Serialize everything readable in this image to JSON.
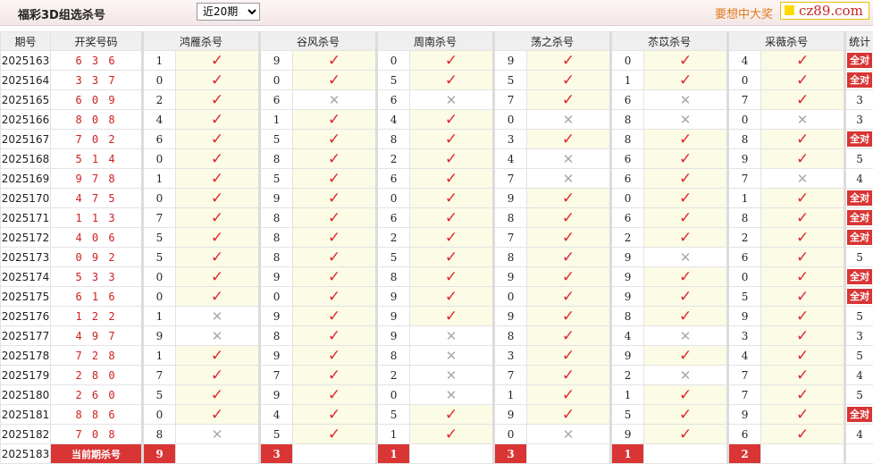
{
  "header": {
    "title": "福彩3D组选杀号",
    "period_select": {
      "selected": "近20期",
      "options": [
        "近20期"
      ]
    },
    "slogan": "要想中大奖",
    "logo_text": "cz89.com"
  },
  "columns": {
    "issue": "期号",
    "draw": "开奖号码",
    "experts": [
      "鸿雁杀号",
      "谷风杀号",
      "周南杀号",
      "荡之杀号",
      "苶苡杀号",
      "采薇杀号"
    ],
    "stat": "统计"
  },
  "all_right_label": "全对",
  "rows": [
    {
      "issue": "2025163",
      "draw": "6 3 6",
      "picks": [
        {
          "n": "1",
          "ok": true
        },
        {
          "n": "9",
          "ok": true
        },
        {
          "n": "0",
          "ok": true
        },
        {
          "n": "9",
          "ok": true
        },
        {
          "n": "0",
          "ok": true
        },
        {
          "n": "4",
          "ok": true
        }
      ],
      "stat": "全对"
    },
    {
      "issue": "2025164",
      "draw": "3 3 7",
      "picks": [
        {
          "n": "0",
          "ok": true
        },
        {
          "n": "0",
          "ok": true
        },
        {
          "n": "5",
          "ok": true
        },
        {
          "n": "5",
          "ok": true
        },
        {
          "n": "1",
          "ok": true
        },
        {
          "n": "0",
          "ok": true
        }
      ],
      "stat": "全对"
    },
    {
      "issue": "2025165",
      "draw": "6 0 9",
      "picks": [
        {
          "n": "2",
          "ok": true
        },
        {
          "n": "6",
          "ok": false
        },
        {
          "n": "6",
          "ok": false
        },
        {
          "n": "7",
          "ok": true
        },
        {
          "n": "6",
          "ok": false
        },
        {
          "n": "7",
          "ok": true
        }
      ],
      "stat": "3"
    },
    {
      "issue": "2025166",
      "draw": "8 0 8",
      "picks": [
        {
          "n": "4",
          "ok": true
        },
        {
          "n": "1",
          "ok": true
        },
        {
          "n": "4",
          "ok": true
        },
        {
          "n": "0",
          "ok": false
        },
        {
          "n": "8",
          "ok": false
        },
        {
          "n": "0",
          "ok": false
        }
      ],
      "stat": "3"
    },
    {
      "issue": "2025167",
      "draw": "7 0 2",
      "picks": [
        {
          "n": "6",
          "ok": true
        },
        {
          "n": "5",
          "ok": true
        },
        {
          "n": "8",
          "ok": true
        },
        {
          "n": "3",
          "ok": true
        },
        {
          "n": "8",
          "ok": true
        },
        {
          "n": "8",
          "ok": true
        }
      ],
      "stat": "全对"
    },
    {
      "issue": "2025168",
      "draw": "5 1 4",
      "picks": [
        {
          "n": "0",
          "ok": true
        },
        {
          "n": "8",
          "ok": true
        },
        {
          "n": "2",
          "ok": true
        },
        {
          "n": "4",
          "ok": false
        },
        {
          "n": "6",
          "ok": true
        },
        {
          "n": "9",
          "ok": true
        }
      ],
      "stat": "5"
    },
    {
      "issue": "2025169",
      "draw": "9 7 8",
      "picks": [
        {
          "n": "1",
          "ok": true
        },
        {
          "n": "5",
          "ok": true
        },
        {
          "n": "6",
          "ok": true
        },
        {
          "n": "7",
          "ok": false
        },
        {
          "n": "6",
          "ok": true
        },
        {
          "n": "7",
          "ok": false
        }
      ],
      "stat": "4"
    },
    {
      "issue": "2025170",
      "draw": "4 7 5",
      "picks": [
        {
          "n": "0",
          "ok": true
        },
        {
          "n": "9",
          "ok": true
        },
        {
          "n": "0",
          "ok": true
        },
        {
          "n": "9",
          "ok": true
        },
        {
          "n": "0",
          "ok": true
        },
        {
          "n": "1",
          "ok": true
        }
      ],
      "stat": "全对"
    },
    {
      "issue": "2025171",
      "draw": "1 1 3",
      "picks": [
        {
          "n": "7",
          "ok": true
        },
        {
          "n": "8",
          "ok": true
        },
        {
          "n": "6",
          "ok": true
        },
        {
          "n": "8",
          "ok": true
        },
        {
          "n": "6",
          "ok": true
        },
        {
          "n": "8",
          "ok": true
        }
      ],
      "stat": "全对"
    },
    {
      "issue": "2025172",
      "draw": "4 0 6",
      "picks": [
        {
          "n": "5",
          "ok": true
        },
        {
          "n": "8",
          "ok": true
        },
        {
          "n": "2",
          "ok": true
        },
        {
          "n": "7",
          "ok": true
        },
        {
          "n": "2",
          "ok": true
        },
        {
          "n": "2",
          "ok": true
        }
      ],
      "stat": "全对"
    },
    {
      "issue": "2025173",
      "draw": "0 9 2",
      "picks": [
        {
          "n": "5",
          "ok": true
        },
        {
          "n": "8",
          "ok": true
        },
        {
          "n": "5",
          "ok": true
        },
        {
          "n": "8",
          "ok": true
        },
        {
          "n": "9",
          "ok": false
        },
        {
          "n": "6",
          "ok": true
        }
      ],
      "stat": "5"
    },
    {
      "issue": "2025174",
      "draw": "5 3 3",
      "picks": [
        {
          "n": "0",
          "ok": true
        },
        {
          "n": "9",
          "ok": true
        },
        {
          "n": "8",
          "ok": true
        },
        {
          "n": "9",
          "ok": true
        },
        {
          "n": "9",
          "ok": true
        },
        {
          "n": "0",
          "ok": true
        }
      ],
      "stat": "全对"
    },
    {
      "issue": "2025175",
      "draw": "6 1 6",
      "picks": [
        {
          "n": "0",
          "ok": true
        },
        {
          "n": "0",
          "ok": true
        },
        {
          "n": "9",
          "ok": true
        },
        {
          "n": "0",
          "ok": true
        },
        {
          "n": "9",
          "ok": true
        },
        {
          "n": "5",
          "ok": true
        }
      ],
      "stat": "全对"
    },
    {
      "issue": "2025176",
      "draw": "1 2 2",
      "picks": [
        {
          "n": "1",
          "ok": false
        },
        {
          "n": "9",
          "ok": true
        },
        {
          "n": "9",
          "ok": true
        },
        {
          "n": "9",
          "ok": true
        },
        {
          "n": "8",
          "ok": true
        },
        {
          "n": "9",
          "ok": true
        }
      ],
      "stat": "5"
    },
    {
      "issue": "2025177",
      "draw": "4 9 7",
      "picks": [
        {
          "n": "9",
          "ok": false
        },
        {
          "n": "8",
          "ok": true
        },
        {
          "n": "9",
          "ok": false
        },
        {
          "n": "8",
          "ok": true
        },
        {
          "n": "4",
          "ok": false
        },
        {
          "n": "3",
          "ok": true
        }
      ],
      "stat": "3"
    },
    {
      "issue": "2025178",
      "draw": "7 2 8",
      "picks": [
        {
          "n": "1",
          "ok": true
        },
        {
          "n": "9",
          "ok": true
        },
        {
          "n": "8",
          "ok": false
        },
        {
          "n": "3",
          "ok": true
        },
        {
          "n": "9",
          "ok": true
        },
        {
          "n": "4",
          "ok": true
        }
      ],
      "stat": "5"
    },
    {
      "issue": "2025179",
      "draw": "2 8 0",
      "picks": [
        {
          "n": "7",
          "ok": true
        },
        {
          "n": "7",
          "ok": true
        },
        {
          "n": "2",
          "ok": false
        },
        {
          "n": "7",
          "ok": true
        },
        {
          "n": "2",
          "ok": false
        },
        {
          "n": "7",
          "ok": true
        }
      ],
      "stat": "4"
    },
    {
      "issue": "2025180",
      "draw": "2 6 0",
      "picks": [
        {
          "n": "5",
          "ok": true
        },
        {
          "n": "9",
          "ok": true
        },
        {
          "n": "0",
          "ok": false
        },
        {
          "n": "1",
          "ok": true
        },
        {
          "n": "1",
          "ok": true
        },
        {
          "n": "7",
          "ok": true
        }
      ],
      "stat": "5"
    },
    {
      "issue": "2025181",
      "draw": "8 8 6",
      "picks": [
        {
          "n": "0",
          "ok": true
        },
        {
          "n": "4",
          "ok": true
        },
        {
          "n": "5",
          "ok": true
        },
        {
          "n": "9",
          "ok": true
        },
        {
          "n": "5",
          "ok": true
        },
        {
          "n": "9",
          "ok": true
        }
      ],
      "stat": "全对"
    },
    {
      "issue": "2025182",
      "draw": "7 0 8",
      "picks": [
        {
          "n": "8",
          "ok": false
        },
        {
          "n": "5",
          "ok": true
        },
        {
          "n": "1",
          "ok": true
        },
        {
          "n": "0",
          "ok": false
        },
        {
          "n": "9",
          "ok": true
        },
        {
          "n": "6",
          "ok": true
        }
      ],
      "stat": "4"
    }
  ],
  "current": {
    "issue": "2025183",
    "label": "当前期杀号",
    "picks": [
      "9",
      "3",
      "1",
      "3",
      "1",
      "2"
    ]
  }
}
